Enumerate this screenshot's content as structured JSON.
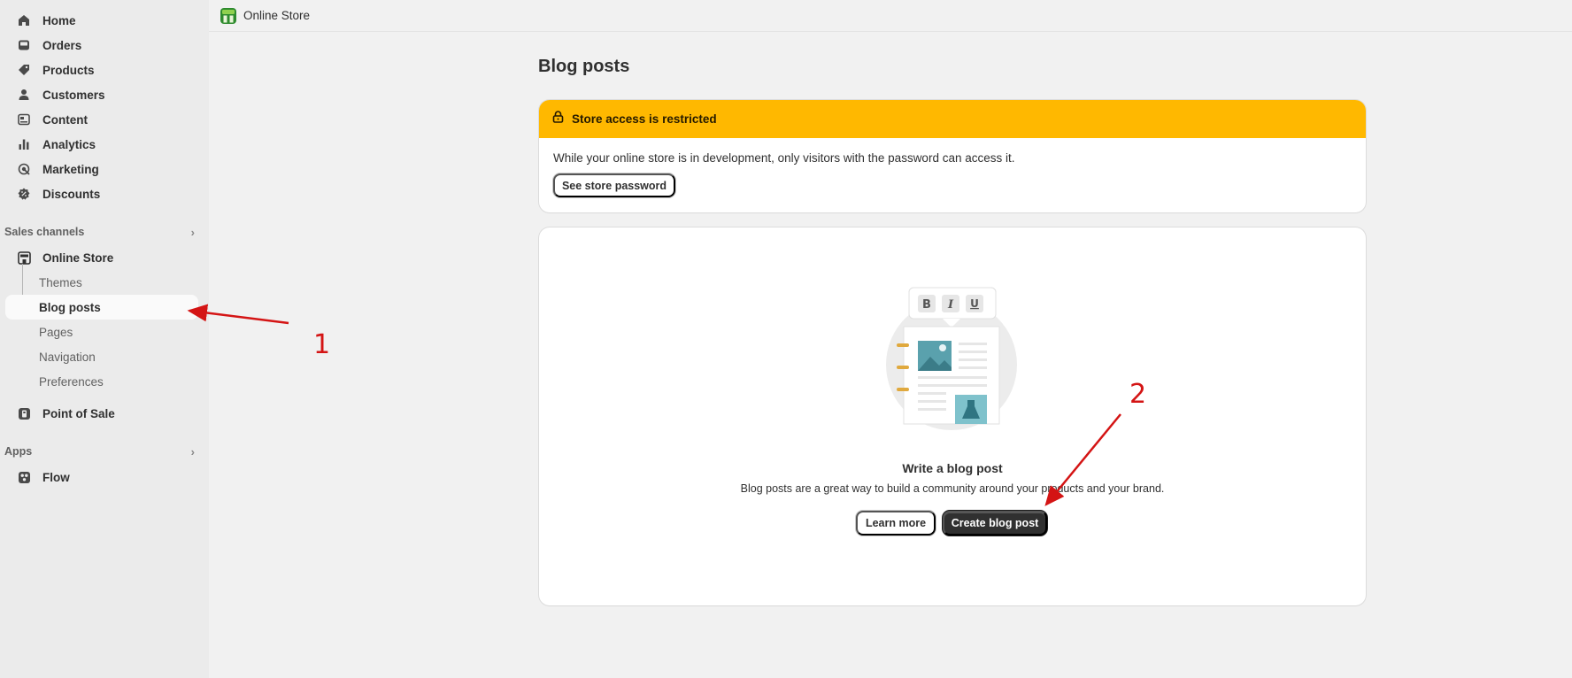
{
  "sidebar": {
    "items": [
      {
        "label": "Home",
        "icon": "home-icon"
      },
      {
        "label": "Orders",
        "icon": "inbox-icon"
      },
      {
        "label": "Products",
        "icon": "tag-icon"
      },
      {
        "label": "Customers",
        "icon": "person-icon"
      },
      {
        "label": "Content",
        "icon": "image-text-icon"
      },
      {
        "label": "Analytics",
        "icon": "bar-chart-icon"
      },
      {
        "label": "Marketing",
        "icon": "target-icon"
      },
      {
        "label": "Discounts",
        "icon": "discount-badge-icon"
      }
    ],
    "sales_channels_label": "Sales channels",
    "online_store": {
      "label": "Online Store",
      "icon": "store-icon",
      "subitems": [
        "Themes",
        "Blog posts",
        "Pages",
        "Navigation",
        "Preferences"
      ],
      "active_subitem": "Blog posts"
    },
    "point_of_sale": {
      "label": "Point of Sale",
      "icon": "pos-icon"
    },
    "apps_label": "Apps",
    "flow": {
      "label": "Flow",
      "icon": "flow-icon"
    }
  },
  "topbar": {
    "title": "Online Store",
    "icon": "online-store-logo-icon"
  },
  "page": {
    "title": "Blog posts"
  },
  "banner": {
    "title": "Store access is restricted",
    "icon": "lock-icon",
    "message": "While your online store is in development, only visitors with the password can access it.",
    "button_label": "See store password",
    "color": "#ffb800"
  },
  "empty_state": {
    "title": "Write a blog post",
    "subtitle": "Blog posts are a great way to build a community around your products and your brand.",
    "secondary_button": "Learn more",
    "primary_button": "Create blog post",
    "format_buttons": [
      "B",
      "I",
      "U"
    ]
  },
  "annotations": {
    "marker_1": "1",
    "marker_2": "2",
    "color": "#d41414"
  }
}
